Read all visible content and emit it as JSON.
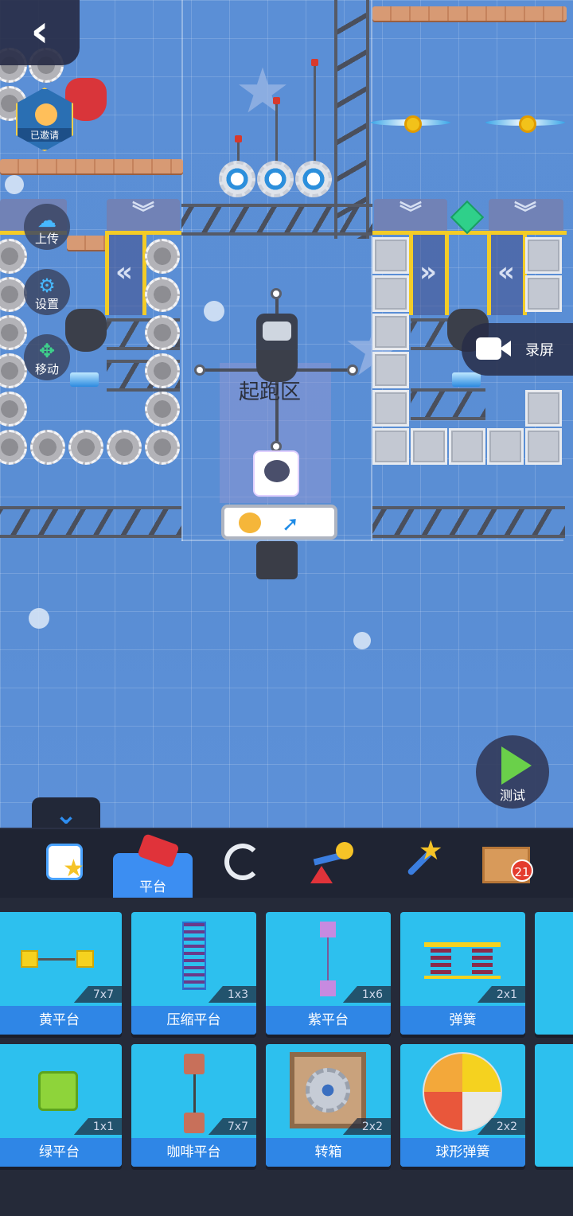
{
  "hud": {
    "back_glyph": "‹",
    "invited_badge": "已邀请",
    "upload_label": "上传",
    "settings_label": "设置",
    "move_label": "移动",
    "record_label": "录屏",
    "test_label": "测试",
    "start_zone_label": "起跑区",
    "collapse_glyph": "⌄"
  },
  "toolbar": {
    "categories": [
      {
        "name": "calendar-star",
        "label": ""
      },
      {
        "name": "platform",
        "label": "平台",
        "active": true
      },
      {
        "name": "trap",
        "label": ""
      },
      {
        "name": "seesaw",
        "label": ""
      },
      {
        "name": "magic-wand",
        "label": ""
      },
      {
        "name": "box",
        "label": "",
        "badge": "21"
      }
    ]
  },
  "items": [
    {
      "name": "黄平台",
      "size": "7x7"
    },
    {
      "name": "压缩平台",
      "size": "1x3"
    },
    {
      "name": "紫平台",
      "size": "1x6"
    },
    {
      "name": "弹簧",
      "size": "2x1"
    },
    {
      "name": "绿平台",
      "size": "1x1"
    },
    {
      "name": "咖啡平台",
      "size": "7x7"
    },
    {
      "name": "转箱",
      "size": "2x2"
    },
    {
      "name": "球形弹簧",
      "size": "2x2"
    }
  ],
  "colors": {
    "accent": "#3c8ef2",
    "card": "#2dc0ee",
    "toolbar": "#1f2433",
    "sky": "#5b8fd6"
  }
}
